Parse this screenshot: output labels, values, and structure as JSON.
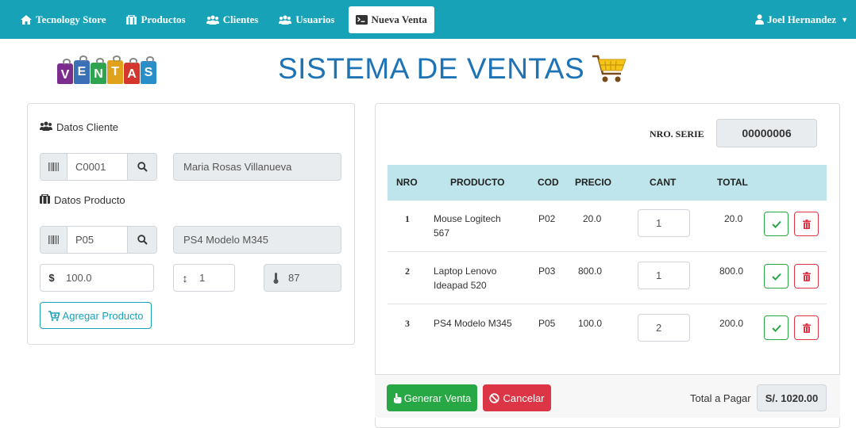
{
  "navbar": {
    "brand": "Tecnology Store",
    "items": [
      {
        "label": "Productos",
        "icon": "shopping-bag-icon"
      },
      {
        "label": "Clientes",
        "icon": "users-icon"
      },
      {
        "label": "Usuarios",
        "icon": "users-icon"
      },
      {
        "label": "Nueva Venta",
        "icon": "terminal-icon",
        "active": true
      }
    ],
    "user": "Joel Hernandez"
  },
  "logo": {
    "letters": [
      "V",
      "E",
      "N",
      "T",
      "A",
      "S"
    ],
    "colors": [
      "#7b2d8e",
      "#3b6fb6",
      "#2fa44f",
      "#e0a21a",
      "#d4352c",
      "#2a8fc9"
    ]
  },
  "title": "SISTEMA DE VENTAS",
  "cliente": {
    "section_label": "Datos Cliente",
    "code": "C0001",
    "name": "Maria Rosas Villanueva"
  },
  "producto": {
    "section_label": "Datos Producto",
    "code": "P05",
    "name": "PS4 Modelo M345",
    "price_symbol": "$",
    "price": "100.0",
    "quantity": "1",
    "stock": "87",
    "add_button": "Agregar Producto"
  },
  "serie": {
    "label": "NRO. SERIE",
    "value": "00000006"
  },
  "table": {
    "headers": [
      "NRO",
      "PRODUCTO",
      "COD",
      "PRECIO",
      "CANT",
      "TOTAL"
    ],
    "rows": [
      {
        "nro": "1",
        "producto_l1": "Mouse Logitech",
        "producto_l2": "567",
        "cod": "P02",
        "precio": "20.0",
        "cant": "1",
        "total": "20.0"
      },
      {
        "nro": "2",
        "producto_l1": "Laptop Lenovo",
        "producto_l2": "Ideapad 520",
        "cod": "P03",
        "precio": "800.0",
        "cant": "1",
        "total": "800.0"
      },
      {
        "nro": "3",
        "producto_l1": "PS4 Modelo M345",
        "producto_l2": "",
        "cod": "P05",
        "precio": "100.0",
        "cant": "2",
        "total": "200.0"
      }
    ]
  },
  "footer": {
    "generate_button": "Generar Venta",
    "cancel_button": "Cancelar",
    "total_label": "Total a Pagar",
    "total_value": "S/. 1020.00"
  },
  "colors": {
    "nav": "#17a2b8",
    "title": "#1e73b5",
    "success": "#28a745",
    "danger": "#dc3545",
    "table_head": "#bee5eb"
  }
}
